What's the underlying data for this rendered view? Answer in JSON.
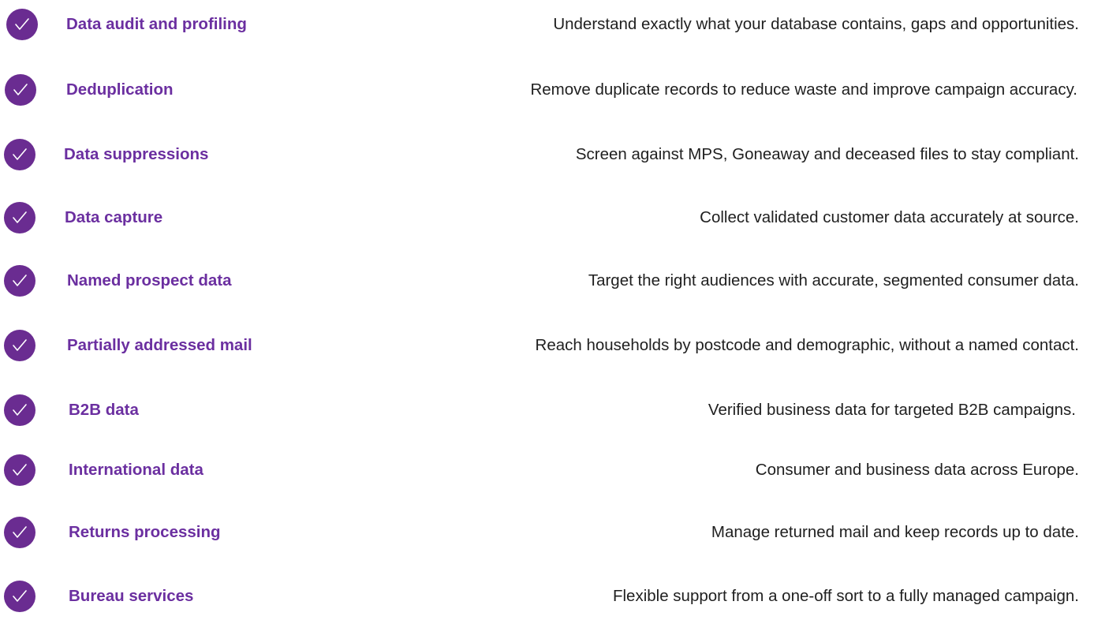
{
  "accent_color": "#6a2c91",
  "icon": "checkmark-circle-icon",
  "services": [
    {
      "name": "Data audit and profiling",
      "description": "Understand exactly what your database contains, gaps and opportunities."
    },
    {
      "name": "Deduplication",
      "description": "Remove duplicate records to reduce waste and improve campaign accuracy."
    },
    {
      "name": "Data suppressions",
      "description": "Screen against MPS, Goneaway and deceased files to stay compliant."
    },
    {
      "name": "Data capture",
      "description": "Collect validated customer data accurately at source."
    },
    {
      "name": "Named prospect data",
      "description": "Target the right audiences with accurate, segmented consumer data."
    },
    {
      "name": "Partially addressed mail",
      "description": "Reach households by postcode and demographic, without a named contact."
    },
    {
      "name": "B2B data",
      "description": "Verified business data for targeted B2B campaigns."
    },
    {
      "name": "International data",
      "description": "Consumer and business data across Europe."
    },
    {
      "name": "Returns processing",
      "description": "Manage returned mail and keep records up to date."
    },
    {
      "name": "Bureau services",
      "description": "Flexible support from a one-off sort to a fully managed campaign."
    }
  ]
}
